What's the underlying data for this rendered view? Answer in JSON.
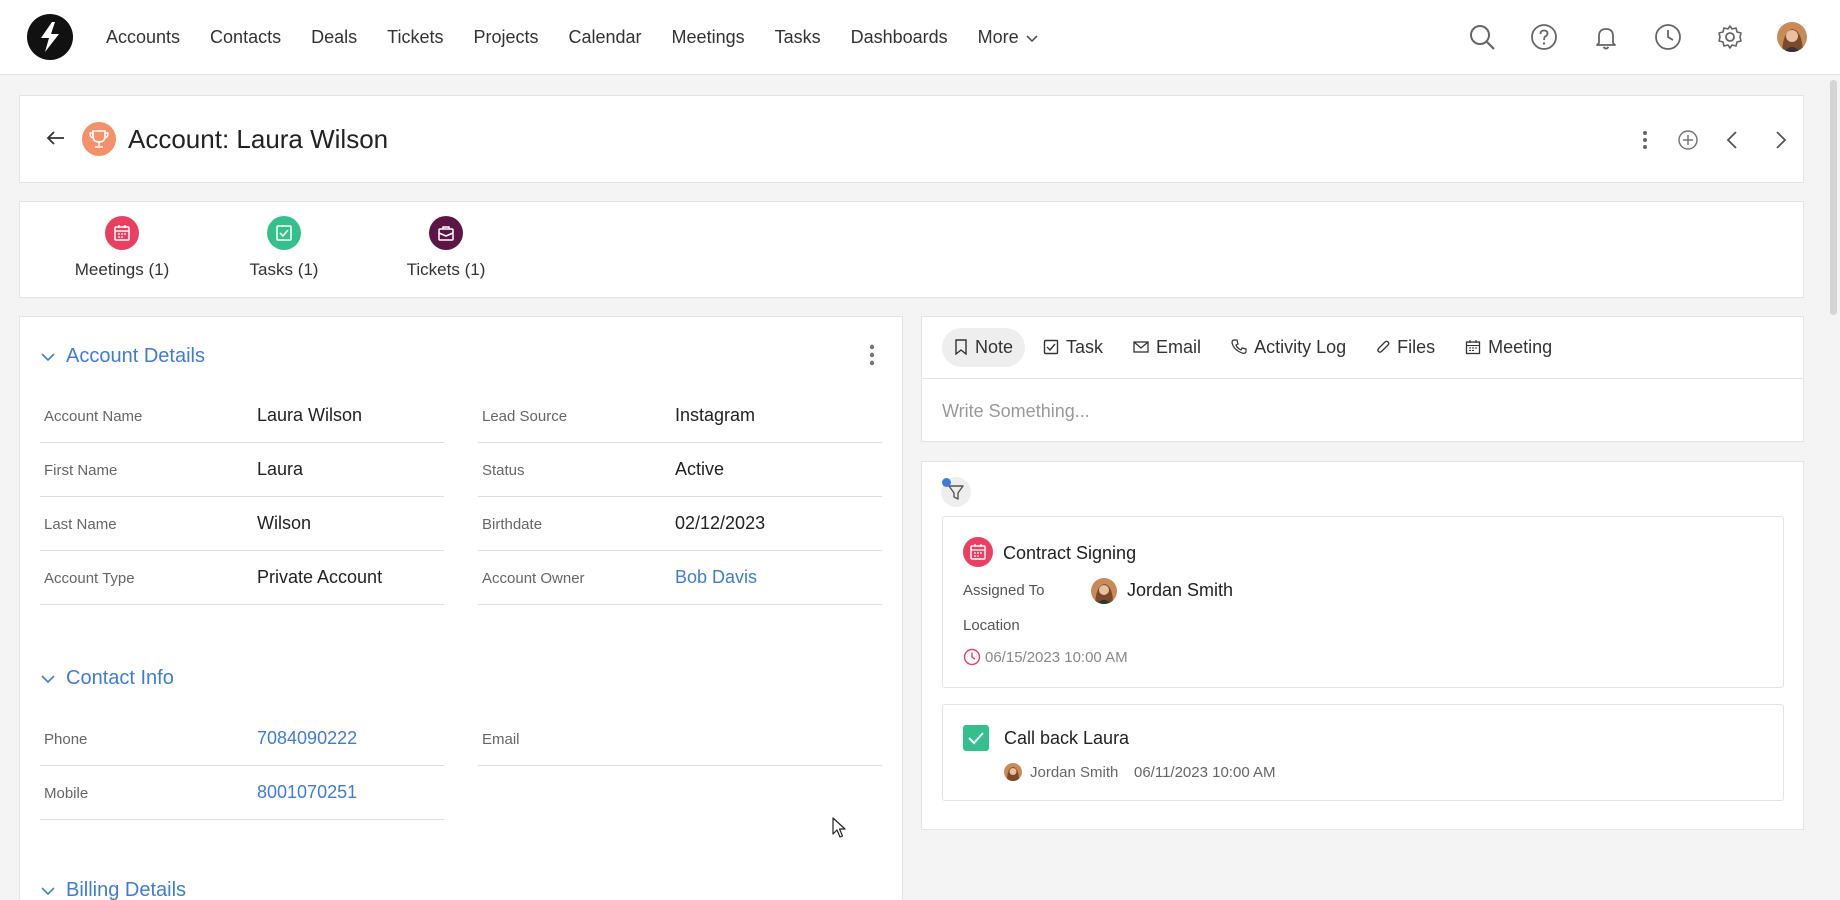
{
  "nav": {
    "items": [
      "Accounts",
      "Contacts",
      "Deals",
      "Tickets",
      "Projects",
      "Calendar",
      "Meetings",
      "Tasks",
      "Dashboards"
    ],
    "more_label": "More"
  },
  "header": {
    "title": "Account: Laura Wilson"
  },
  "related": [
    {
      "label": "Meetings (1)",
      "color": "#ea3f61"
    },
    {
      "label": "Tasks (1)",
      "color": "#33c08c"
    },
    {
      "label": "Tickets (1)",
      "color": "#5b1547"
    }
  ],
  "account_details": {
    "title": "Account Details",
    "fields": [
      {
        "label": "Account Name",
        "value": "Laura Wilson"
      },
      {
        "label": "Lead Source",
        "value": "Instagram"
      },
      {
        "label": "First Name",
        "value": "Laura"
      },
      {
        "label": "Status",
        "value": "Active"
      },
      {
        "label": "Last Name",
        "value": "Wilson"
      },
      {
        "label": "Birthdate",
        "value": "02/12/2023"
      },
      {
        "label": "Account Type",
        "value": "Private Account"
      },
      {
        "label": "Account Owner",
        "value": "Bob Davis"
      }
    ]
  },
  "contact_info": {
    "title": "Contact Info",
    "fields": [
      {
        "label": "Phone",
        "value": "7084090222"
      },
      {
        "label": "Email",
        "value": ""
      },
      {
        "label": "Mobile",
        "value": "8001070251"
      }
    ]
  },
  "billing": {
    "title": "Billing Details"
  },
  "composer": {
    "tabs": [
      "Note",
      "Task",
      "Email",
      "Activity Log",
      "Files",
      "Meeting"
    ],
    "placeholder": "Write Something..."
  },
  "activities": {
    "meeting": {
      "title": "Contract Signing",
      "assigned_label": "Assigned To",
      "assignee": "Jordan Smith",
      "location_label": "Location",
      "datetime": "06/15/2023 10:00 AM"
    },
    "task": {
      "title": "Call back Laura",
      "assignee": "Jordan Smith",
      "datetime": "06/11/2023 10:00 AM"
    }
  },
  "colors": {
    "accent": "#3f7cd8",
    "meeting_red": "#ea3f61",
    "task_green": "#33c08c",
    "ticket_purple": "#5b1547",
    "trophy_orange": "#f4906a"
  }
}
